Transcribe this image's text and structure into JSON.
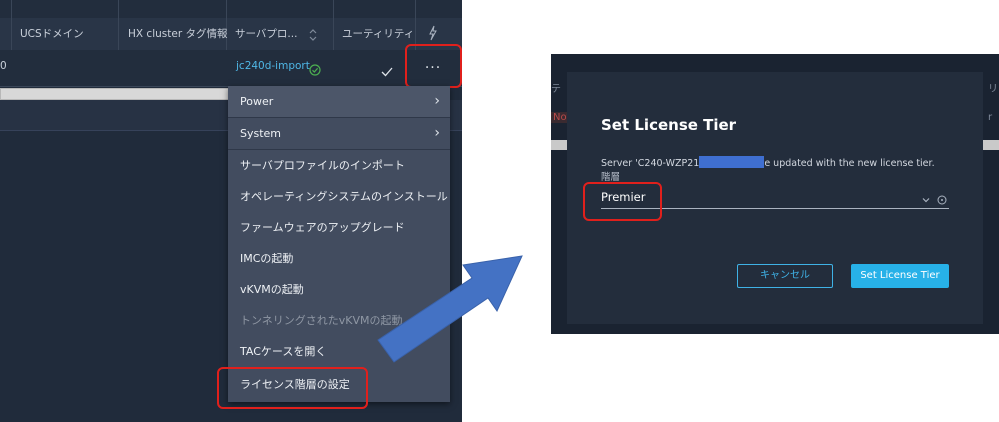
{
  "left_panel": {
    "columns": {
      "ucs_domain": "UCSドメイン",
      "hx_cluster_tags": "HX cluster タグ情報",
      "server_profile": "サーバプロ...",
      "utility": "ユーティリティ"
    },
    "row": {
      "cut_value": "0",
      "server_profile_link": "jc240d-import",
      "more_menu_label": "..."
    },
    "menu_items": [
      {
        "label": "Power",
        "has_submenu": true
      },
      {
        "label": "System",
        "has_submenu": true
      },
      {
        "label": "サーバプロファイルのインポート"
      },
      {
        "label": "オペレーティングシステムのインストール"
      },
      {
        "label": "ファームウェアのアップグレード"
      },
      {
        "label": "IMCの起動"
      },
      {
        "label": "vKVMの起動"
      },
      {
        "label": "トンネリングされたvKVMの起動",
        "disabled": true
      },
      {
        "label": "TACケースを開く"
      },
      {
        "label": "ライセンス階層の設定"
      }
    ]
  },
  "right_panel": {
    "bg_fragments": {
      "top_left": "テ",
      "top_right": "リ",
      "status_left": "Not",
      "status_right": "r"
    },
    "dialog": {
      "title": "Set License Tier",
      "message_prefix": "Server 'C240-WZP21",
      "message_suffix": "e updated with the new license tier.",
      "field_label": "階層",
      "selected_tier": "Premier",
      "cancel_label": "キャンセル",
      "submit_label": "Set License Tier"
    }
  },
  "colors": {
    "highlight_box": "#e0201c",
    "arrow": "#4472c4",
    "accent_button": "#27b1e8",
    "link": "#4fb7e6",
    "success": "#4caf50"
  }
}
